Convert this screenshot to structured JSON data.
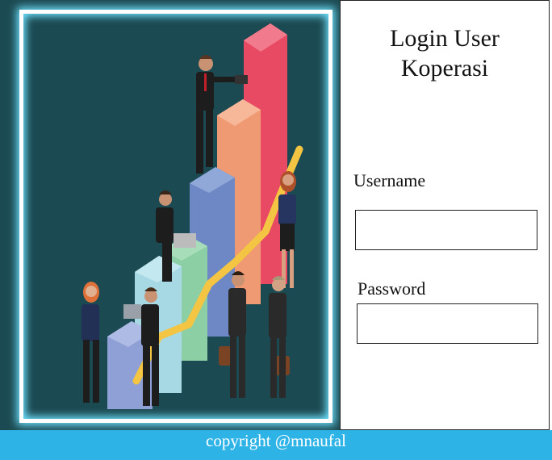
{
  "login": {
    "title_line1": "Login User",
    "title_line2": "Koperasi",
    "username_label": "Username",
    "username_value": "",
    "password_label": "Password",
    "password_value": ""
  },
  "footer": {
    "copyright": "copyright @mnaufal"
  },
  "hero": {
    "illustration": "business-growth-illustration",
    "background_color": "#1c4a52",
    "glow_color": "#6ee2ff"
  },
  "colors": {
    "footer_bg": "#2eb3e6",
    "panel_border": "#222222"
  }
}
